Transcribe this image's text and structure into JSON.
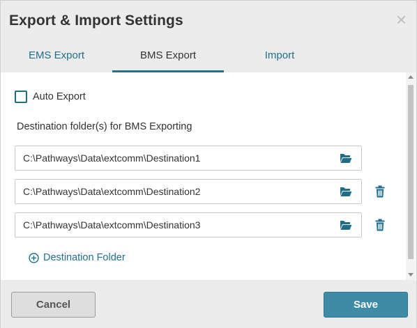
{
  "dialog": {
    "title": "Export & Import Settings",
    "close_symbol": "×"
  },
  "tabs": [
    {
      "label": "EMS Export",
      "active": false
    },
    {
      "label": "BMS Export",
      "active": true
    },
    {
      "label": "Import",
      "active": false
    }
  ],
  "auto_export": {
    "label": "Auto Export",
    "checked": false
  },
  "destination": {
    "section_label": "Destination folder(s) for BMS Exporting",
    "folders": [
      {
        "path": "C:\\Pathways\\Data\\extcomm\\Destination1",
        "browse_icon": "folder-open-icon",
        "deletable": false
      },
      {
        "path": "C:\\Pathways\\Data\\extcomm\\Destination2",
        "browse_icon": "folder-open-icon",
        "deletable": true,
        "delete_icon": "trash-icon"
      },
      {
        "path": "C:\\Pathways\\Data\\extcomm\\Destination3",
        "browse_icon": "folder-open-icon",
        "deletable": true,
        "delete_icon": "trash-icon"
      }
    ],
    "add_label": "Destination Folder",
    "add_icon": "plus-circle-icon"
  },
  "footer": {
    "cancel_label": "Cancel",
    "save_label": "Save"
  },
  "colors": {
    "accent": "#1f6f8b",
    "save_bg": "#3d8ba6",
    "header_bg": "#ececec"
  }
}
